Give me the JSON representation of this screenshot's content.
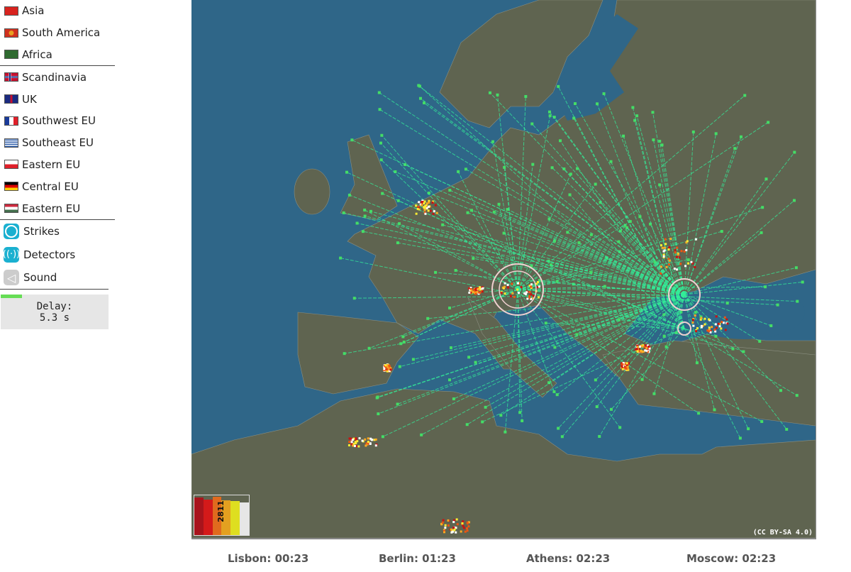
{
  "sidebar": {
    "regions": [
      {
        "label": "Asia",
        "flag": "hk"
      },
      {
        "label": "South America",
        "flag": "br"
      },
      {
        "label": "Africa",
        "flag": "af"
      }
    ],
    "europe": [
      {
        "label": "Scandinavia",
        "flag": "no"
      },
      {
        "label": "UK",
        "flag": "uk"
      },
      {
        "label": "Southwest EU",
        "flag": "fr"
      },
      {
        "label": "Southeast EU",
        "flag": "gr"
      },
      {
        "label": "Eastern EU",
        "flag": "pl"
      },
      {
        "label": "Central EU",
        "flag": "de"
      },
      {
        "label": "Eastern EU",
        "flag": "hu"
      }
    ],
    "tools": {
      "strikes": "Strikes",
      "detectors": "Detectors",
      "sound": "Sound"
    },
    "delay": {
      "label": "Delay:",
      "value": "5.3 s",
      "progress": 0.2
    }
  },
  "map": {
    "license": "(CC BY-SA 4.0)",
    "strike_count": "2811",
    "legend_colors": [
      "#a8141c",
      "#d41a1a",
      "#e06a1e",
      "#e3a020",
      "#dede20",
      "#e6e6e6"
    ],
    "colors": {
      "sea": "#2f6688",
      "land": "#5f6450",
      "lines": "#33ee99"
    }
  },
  "clocks": [
    {
      "label": "Lisbon: 00:23"
    },
    {
      "label": "Berlin: 01:23"
    },
    {
      "label": "Athens: 02:23"
    },
    {
      "label": "Moscow: 02:23"
    }
  ]
}
